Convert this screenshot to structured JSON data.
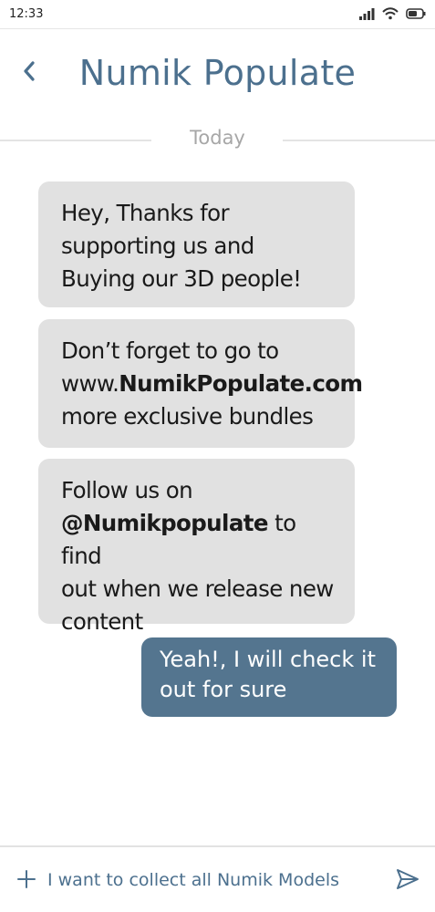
{
  "status_bar": {
    "time": "12:33",
    "icons": [
      "signal-icon",
      "wifi-icon",
      "battery-icon"
    ]
  },
  "header": {
    "title": "Numik Populate",
    "back_icon": "chevron-left-icon"
  },
  "divider": {
    "label": "Today"
  },
  "messages": [
    {
      "direction": "incoming",
      "lines": [
        "Hey, Thanks for",
        "supporting us and",
        "Buying our 3D people!"
      ]
    },
    {
      "direction": "incoming",
      "line1": "Don’t forget to go to",
      "line2_prefix": "www.",
      "line2_bold": "NumikPopulate.com",
      "line3": "more exclusive bundles"
    },
    {
      "direction": "incoming",
      "line1": "Follow us on",
      "line2_bold": "@Numikpopulate",
      "line2_suffix": " to find",
      "line3": "out when we release new",
      "line4": "content"
    },
    {
      "direction": "outgoing",
      "lines": [
        "Yeah!, I will check it",
        "out for sure"
      ]
    }
  ],
  "composer": {
    "value": "I want to collect all Numik Models",
    "add_icon": "plus-icon",
    "send_icon": "send-icon"
  },
  "colors": {
    "accent": "#4c708e",
    "outgoing_bubble": "#54758f",
    "incoming_bubble": "#e1e1e1"
  }
}
